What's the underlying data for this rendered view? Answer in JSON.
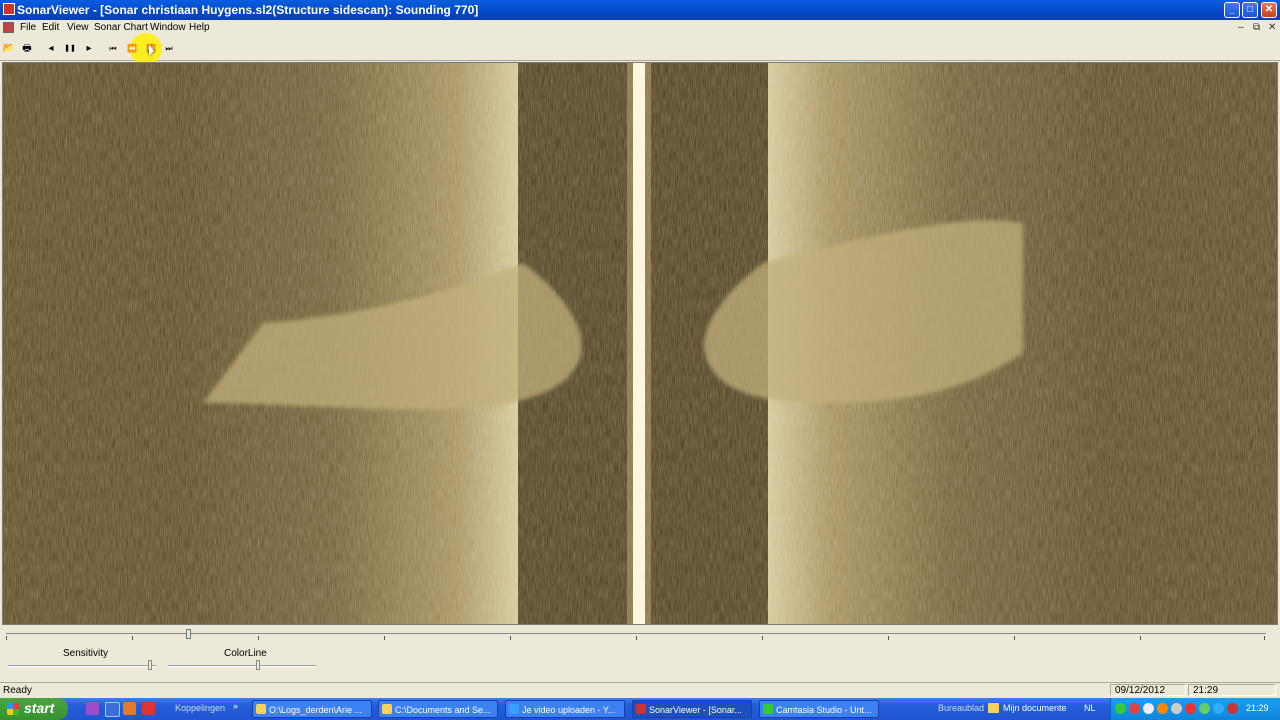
{
  "window": {
    "title": "SonarViewer - [Sonar christiaan Huygens.sl2(Structure sidescan): Sounding 770]",
    "buttons": {
      "minimize": "_",
      "maximize": "□",
      "close": "✕"
    }
  },
  "menu": {
    "items": [
      "File",
      "Edit",
      "View",
      "Sonar Chart",
      "Window",
      "Help"
    ],
    "mdi_buttons": {
      "minimize": "–",
      "restore": "⧉",
      "close": "✕"
    }
  },
  "toolbar": {
    "buttons": [
      {
        "name": "open-icon",
        "glyph": "📂"
      },
      {
        "name": "print-icon",
        "glyph": "🖶"
      },
      {
        "name": "step-back-icon",
        "glyph": "◂"
      },
      {
        "name": "pause-icon",
        "glyph": "❚❚"
      },
      {
        "name": "play-icon",
        "glyph": "▸"
      },
      {
        "name": "skip-start-icon",
        "glyph": "⏮"
      },
      {
        "name": "rewind-icon",
        "glyph": "⏪"
      },
      {
        "name": "fast-forward-icon",
        "glyph": "⏩"
      },
      {
        "name": "skip-end-icon",
        "glyph": "⏭"
      }
    ]
  },
  "controls": {
    "sensitivity_label": "Sensitivity",
    "colorline_label": "ColorLine"
  },
  "status": {
    "text": "Ready",
    "date": "09/12/2012",
    "time": "21:29"
  },
  "taskbar": {
    "start_label": "start",
    "tasks": [
      "Koppelingen",
      "O:\\Logs_derden\\Arie ...",
      "C:\\Documents and Se...",
      "Je video uploaden - Y...",
      "SonarViewer - [Sonar...",
      "Camtasia Studio - Unt..."
    ],
    "desktop_label": "Bureaublad",
    "documents_label": "Mijn documente",
    "language": "NL",
    "clock": "21:29"
  },
  "colors": {
    "sonar_background": "#574520",
    "sonar_bright": "#f0e4b8",
    "xp_blue": "#245edb",
    "start_green": "#36912f"
  }
}
